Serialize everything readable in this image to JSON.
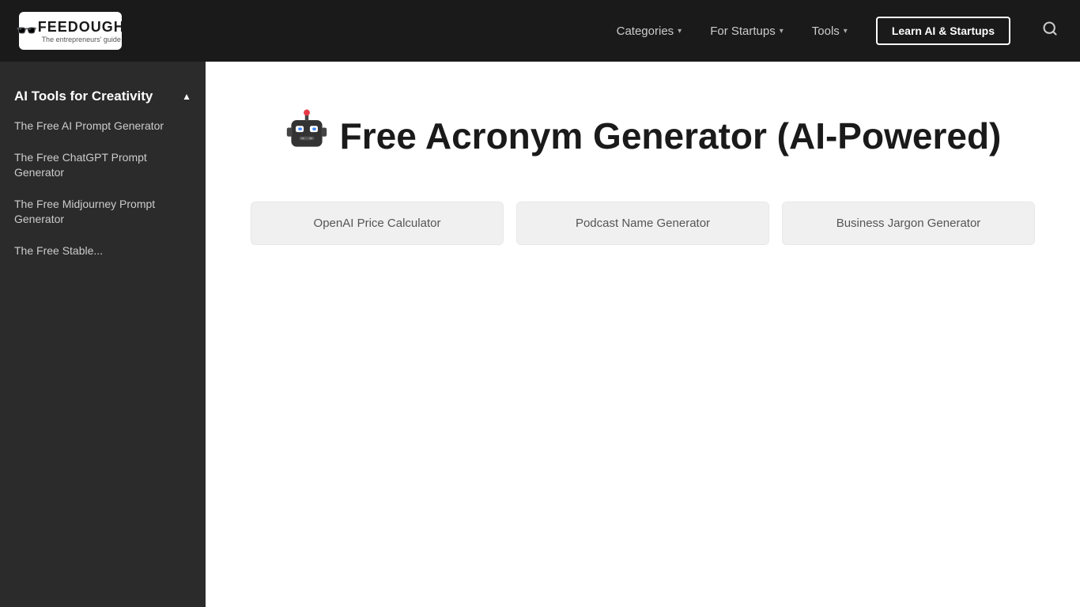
{
  "navbar": {
    "logo_text": "FEEDOUGH",
    "logo_tagline": "The entrepreneurs' guide",
    "nav_items": [
      {
        "label": "Categories",
        "has_dropdown": true
      },
      {
        "label": "For Startups",
        "has_dropdown": true
      },
      {
        "label": "Tools",
        "has_dropdown": true
      }
    ],
    "cta_label": "Learn AI & Startups",
    "search_icon": "🔍"
  },
  "sidebar": {
    "section_title": "AI Tools for Creativity",
    "toggle_icon": "▲",
    "links": [
      {
        "label": "The Free AI Prompt Generator"
      },
      {
        "label": "The Free ChatGPT Prompt Generator"
      },
      {
        "label": "The Free Midjourney Prompt Generator"
      },
      {
        "label": "The Free Stable..."
      }
    ]
  },
  "main": {
    "robot_emoji": "🤖",
    "page_title": "Free Acronym Generator (AI-Powered)",
    "related_tools": [
      {
        "label": "OpenAI Price Calculator"
      },
      {
        "label": "Podcast Name Generator"
      },
      {
        "label": "Business Jargon Generator"
      }
    ]
  }
}
